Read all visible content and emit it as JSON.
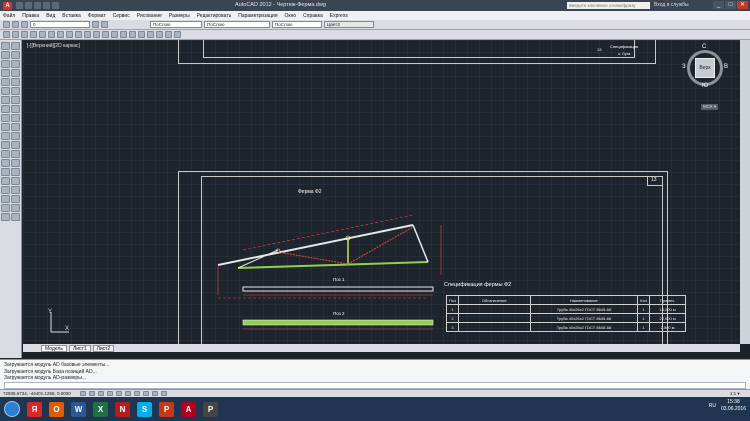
{
  "window": {
    "title": "AutoCAD 2012 - Чертеж-Ферма.dwg",
    "search_placeholder": "Введите ключевое слово/фразу",
    "login_label": "Вход в службы",
    "controls": {
      "minimize": "_",
      "maximize": "□",
      "close": "✕"
    }
  },
  "menu": [
    "Файл",
    "Правка",
    "Вид",
    "Вставка",
    "Формат",
    "Сервис",
    "Рисование",
    "Размеры",
    "Редактировать",
    "Параметризация",
    "Окно",
    "Справка",
    "Express"
  ],
  "toolbar": {
    "layer_combo": "0",
    "color_combo": "ПоСлою",
    "linetype_combo": "ПоСлою",
    "lineweight_combo": "ПоСлою",
    "plotstyle_combo": "ЦветЗ"
  },
  "viewport_label": "[-][Верхний][2D каркас]",
  "viewcube": {
    "face": "Верх",
    "north": "С",
    "south": "Ю",
    "west": "З",
    "east": "В",
    "wcs": "МСК ▾"
  },
  "drawing": {
    "truss_title": "Ферма Ф2",
    "sheet_number": "13",
    "stamp_number": "13",
    "stamp_text_1": "Спецификация",
    "stamp_text_2": "з. Луга",
    "pos1_label": "Поз 1",
    "pos2_label": "Поз 2"
  },
  "spec": {
    "title": "Спецификация фермы Ф2",
    "headers": [
      "Поз",
      "Обозначение",
      "Наименование",
      "Кол",
      "Примеч."
    ],
    "rows": [
      [
        "1",
        "",
        "Труба 40х25х2 ГОСТ 8645-68",
        "1",
        "14,000 м"
      ],
      [
        "2",
        "",
        "Труба 40х25х2 ГОСТ 8645-68",
        "1",
        "22,000 м"
      ],
      [
        "3",
        "",
        "Труба 40х25х2 ГОСТ 8645-68",
        "1",
        "2,500 м"
      ]
    ]
  },
  "tabs": [
    "Модель",
    "Лист1",
    "Лист2"
  ],
  "command_history": [
    "Загружается модуль AD базовые элементы...",
    "Загружается модуль База позиций AD...",
    "Загружается модуль AD-размеры...",
    "Загружается модуль Спецификация AD..."
  ],
  "status": {
    "coords": "72935.6734, -44401.1258, 0.0000",
    "scale": "1:1 ▾"
  },
  "taskbar": {
    "lang": "RU",
    "time": "15:38",
    "date": "03.06.2016",
    "apps": [
      "Я",
      "O",
      "W",
      "X",
      "N",
      "S",
      "P",
      "A",
      "P"
    ]
  }
}
